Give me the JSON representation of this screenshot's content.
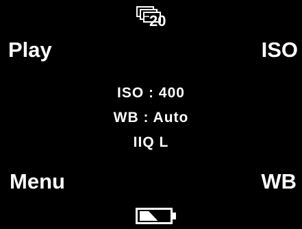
{
  "softkeys": {
    "top_left": "Play",
    "top_right": "ISO",
    "bottom_left": "Menu",
    "bottom_right": "WB"
  },
  "frames_remaining": {
    "icon": "stacked-frames-icon",
    "count": "20"
  },
  "status": {
    "iso_line": "ISO : 400",
    "wb_line": "WB : Auto",
    "quality_line": "IIQ L"
  },
  "battery": {
    "icon": "battery-icon",
    "level_fraction": 0.5
  },
  "colors": {
    "background": "#000000",
    "foreground": "#ffffff"
  }
}
